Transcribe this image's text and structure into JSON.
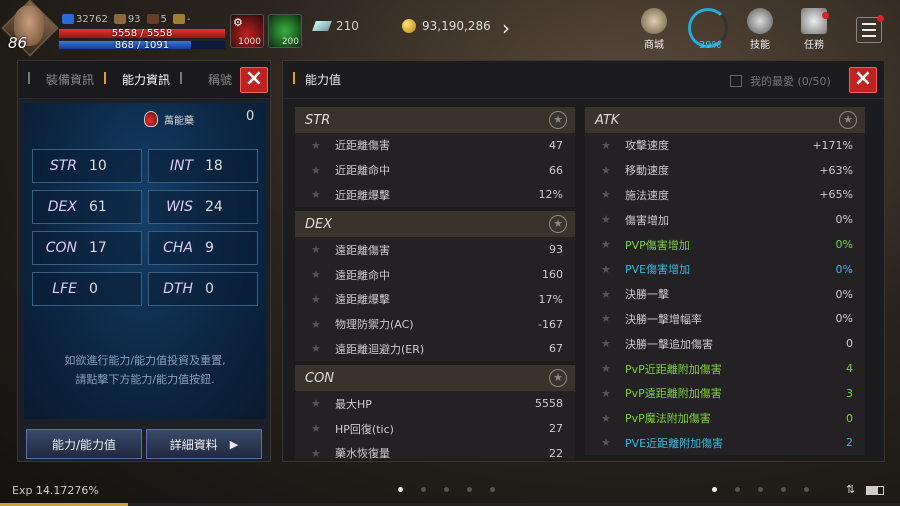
{
  "hud": {
    "level": "86",
    "buff1": "32762",
    "buff2": "93",
    "buff3": "5",
    "buff4": "-",
    "hp_text": "5558 / 5558",
    "hp_fraction": 1.0,
    "mp_text": "868 / 1091",
    "mp_fraction": 0.7956,
    "potion_count": "1000",
    "herb_count": "200",
    "crystals": "210",
    "gold": "93,190,286",
    "shop_label": "商城",
    "weight_pct": "39%",
    "skills_label": "技能",
    "quest_label": "任務"
  },
  "left": {
    "tabs": [
      "裝備資訊",
      "能力資訊",
      "稱號"
    ],
    "active_tab": 1,
    "potion_label": "萬能藥",
    "potion_value": "0",
    "stats": [
      {
        "k": "STR",
        "v": "10"
      },
      {
        "k": "INT",
        "v": "18"
      },
      {
        "k": "DEX",
        "v": "61"
      },
      {
        "k": "WIS",
        "v": "24"
      },
      {
        "k": "CON",
        "v": "17"
      },
      {
        "k": "CHA",
        "v": "9"
      },
      {
        "k": "LFE",
        "v": "0"
      },
      {
        "k": "DTH",
        "v": "0"
      }
    ],
    "hint_line1": "如欲進行能力/能力值投資及重置,",
    "hint_line2": "請點擊下方能力/能力值按鈕.",
    "btn_ability": "能力/能力值",
    "btn_detail": "詳細資料"
  },
  "right": {
    "title": "能力值",
    "favorite": "我的最愛 (0/50)",
    "left_sections": [
      {
        "name": "STR",
        "rows": [
          {
            "n": "近距離傷害",
            "v": "47"
          },
          {
            "n": "近距離命中",
            "v": "66"
          },
          {
            "n": "近距離爆擊",
            "v": "12%"
          }
        ]
      },
      {
        "name": "DEX",
        "rows": [
          {
            "n": "遠距離傷害",
            "v": "93"
          },
          {
            "n": "遠距離命中",
            "v": "160"
          },
          {
            "n": "遠距離爆擊",
            "v": "17%"
          },
          {
            "n": "物理防禦力(AC)",
            "v": "-167"
          },
          {
            "n": "遠距離迴避力(ER)",
            "v": "67"
          }
        ]
      },
      {
        "name": "CON",
        "rows": [
          {
            "n": "最大HP",
            "v": "5558"
          },
          {
            "n": "HP回復(tic)",
            "v": "27"
          },
          {
            "n": "藥水恢復量",
            "v": "22"
          }
        ]
      }
    ],
    "atk_section": {
      "name": "ATK",
      "rows": [
        {
          "n": "攻擊速度",
          "v": "+171%",
          "c": ""
        },
        {
          "n": "移動速度",
          "v": "+63%",
          "c": ""
        },
        {
          "n": "施法速度",
          "v": "+65%",
          "c": ""
        },
        {
          "n": "傷害增加",
          "v": "0%",
          "c": ""
        },
        {
          "n": "PVP傷害增加",
          "v": "0%",
          "c": "green"
        },
        {
          "n": "PVE傷害增加",
          "v": "0%",
          "c": "cyan"
        },
        {
          "n": "決勝一擊",
          "v": "0%",
          "c": ""
        },
        {
          "n": "決勝一擊增幅率",
          "v": "0%",
          "c": ""
        },
        {
          "n": "決勝一擊追加傷害",
          "v": "0",
          "c": ""
        },
        {
          "n": "PvP近距離附加傷害",
          "v": "4",
          "c": "green"
        },
        {
          "n": "PvP遠距離附加傷害",
          "v": "3",
          "c": "green"
        },
        {
          "n": "PvP魔法附加傷害",
          "v": "0",
          "c": "green"
        },
        {
          "n": "PVE近距離附加傷害",
          "v": "2",
          "c": "cyan"
        }
      ]
    }
  },
  "bottom": {
    "exp": "Exp 14.17276%",
    "exp_fraction": 0.1417
  },
  "colors": {
    "close": "#c02222",
    "accent": "#e0a030",
    "green": "#7cd042",
    "cyan": "#3ab8d8"
  }
}
